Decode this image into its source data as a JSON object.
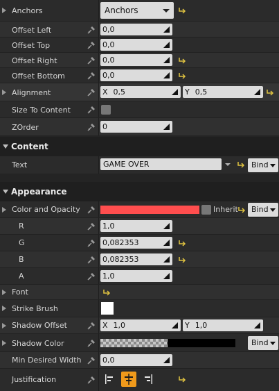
{
  "anchors": {
    "label": "Anchors",
    "value": "Anchors"
  },
  "offset_left": {
    "label": "Offset Left",
    "value": "0,0"
  },
  "offset_top": {
    "label": "Offset Top",
    "value": "0,0"
  },
  "offset_right": {
    "label": "Offset Right",
    "value": "0,0"
  },
  "offset_bottom": {
    "label": "Offset Bottom",
    "value": "0,0"
  },
  "alignment": {
    "label": "Alignment",
    "x_label": "X",
    "x_value": "0,5",
    "y_label": "Y",
    "y_value": "0,5"
  },
  "size_to_content": {
    "label": "Size To Content",
    "checked": false
  },
  "zorder": {
    "label": "ZOrder",
    "value": "0"
  },
  "content": {
    "section_title": "Content",
    "text": {
      "label": "Text",
      "value": "GAME OVER",
      "bind_label": "Bind"
    }
  },
  "appearance": {
    "section_title": "Appearance",
    "color_opacity": {
      "label": "Color and Opacity",
      "color": "#ff4e4e",
      "inherit_label": "Inherit",
      "bind_label": "Bind"
    },
    "r": {
      "label": "R",
      "value": "1,0"
    },
    "g": {
      "label": "G",
      "value": "0,082353"
    },
    "b": {
      "label": "B",
      "value": "0,082353"
    },
    "a": {
      "label": "A",
      "value": "1,0"
    },
    "font": {
      "label": "Font"
    },
    "strike_brush": {
      "label": "Strike Brush",
      "color": "#ffffff"
    },
    "shadow_offset": {
      "label": "Shadow Offset",
      "x_label": "X",
      "x_value": "1,0",
      "y_label": "Y",
      "y_value": "1,0"
    },
    "shadow_color": {
      "label": "Shadow Color",
      "bind_label": "Bind"
    },
    "min_desired_width": {
      "label": "Min Desired Width",
      "value": "0,0"
    },
    "justification": {
      "label": "Justification",
      "options": [
        "left-align-icon",
        "center-align-icon",
        "right-align-icon"
      ],
      "selected": 1
    }
  },
  "colors": {
    "accent": "#f09a1b",
    "reset_arrow": "#e0c341",
    "field_bg": "#dcdcdc"
  }
}
